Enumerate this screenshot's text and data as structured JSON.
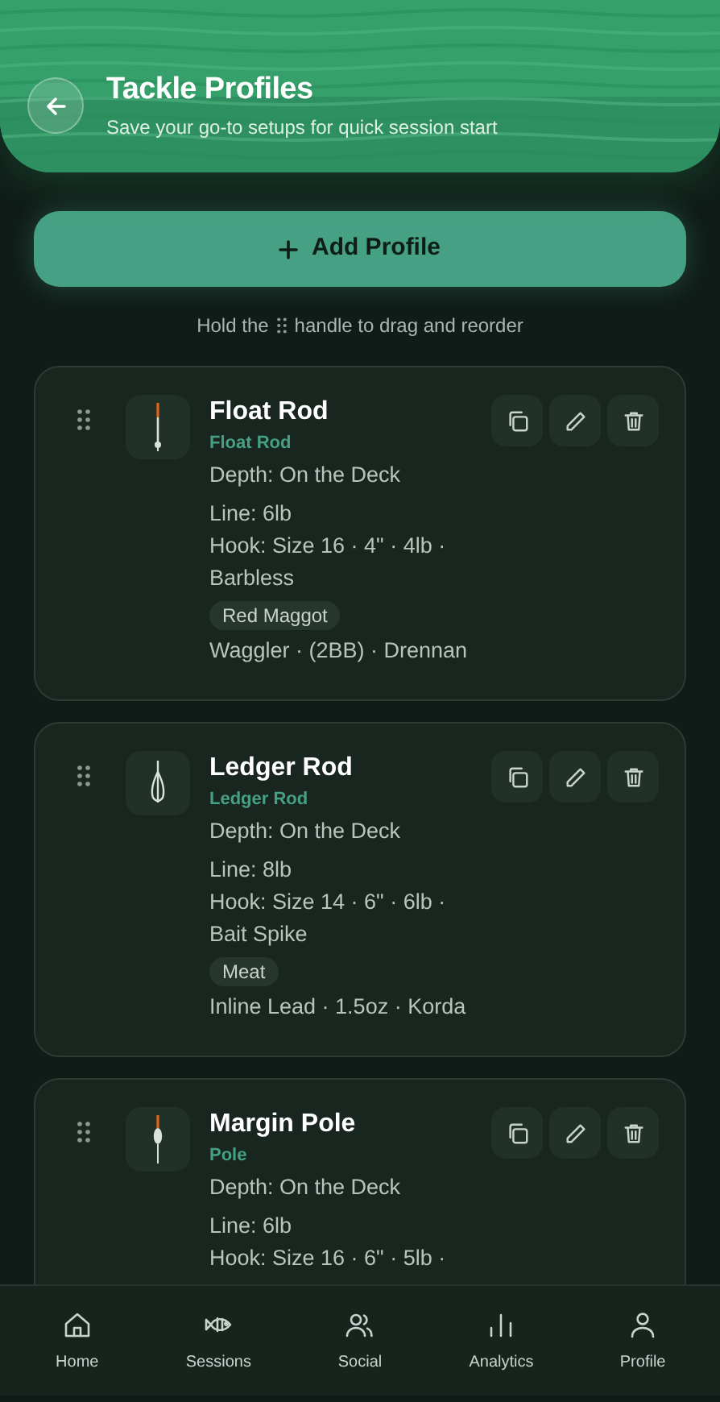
{
  "header": {
    "title": "Tackle Profiles",
    "subtitle": "Save your go-to setups for quick session start"
  },
  "add_button": {
    "label": "Add Profile"
  },
  "hint": {
    "before": "Hold the",
    "after": "handle to drag and reorder"
  },
  "profiles": [
    {
      "kind": "float",
      "name": "Float Rod",
      "type": "Float Rod",
      "depth": "Depth: On the Deck",
      "line": "Line: 6lb",
      "hook": "Hook: Size 16 · 4\" · 4lb · Barbless",
      "bait": "Red Maggot",
      "rig": "Waggler · (2BB) · Drennan"
    },
    {
      "kind": "ledger",
      "name": "Ledger Rod",
      "type": "Ledger Rod",
      "depth": "Depth: On the Deck",
      "line": "Line: 8lb",
      "hook": "Hook: Size 14 · 6\" · 6lb · Bait Spike",
      "bait": "Meat",
      "rig": "Inline Lead · 1.5oz · Korda"
    },
    {
      "kind": "pole",
      "name": "Margin Pole",
      "type": "Pole",
      "depth": "Depth: On the Deck",
      "line": "Line: 6lb",
      "hook": "Hook: Size 16 · 6\" · 5lb ·"
    }
  ],
  "nav": [
    {
      "kind": "home",
      "label": "Home"
    },
    {
      "kind": "sessions",
      "label": "Sessions"
    },
    {
      "kind": "social",
      "label": "Social"
    },
    {
      "kind": "analytics",
      "label": "Analytics"
    },
    {
      "kind": "profile",
      "label": "Profile"
    }
  ]
}
